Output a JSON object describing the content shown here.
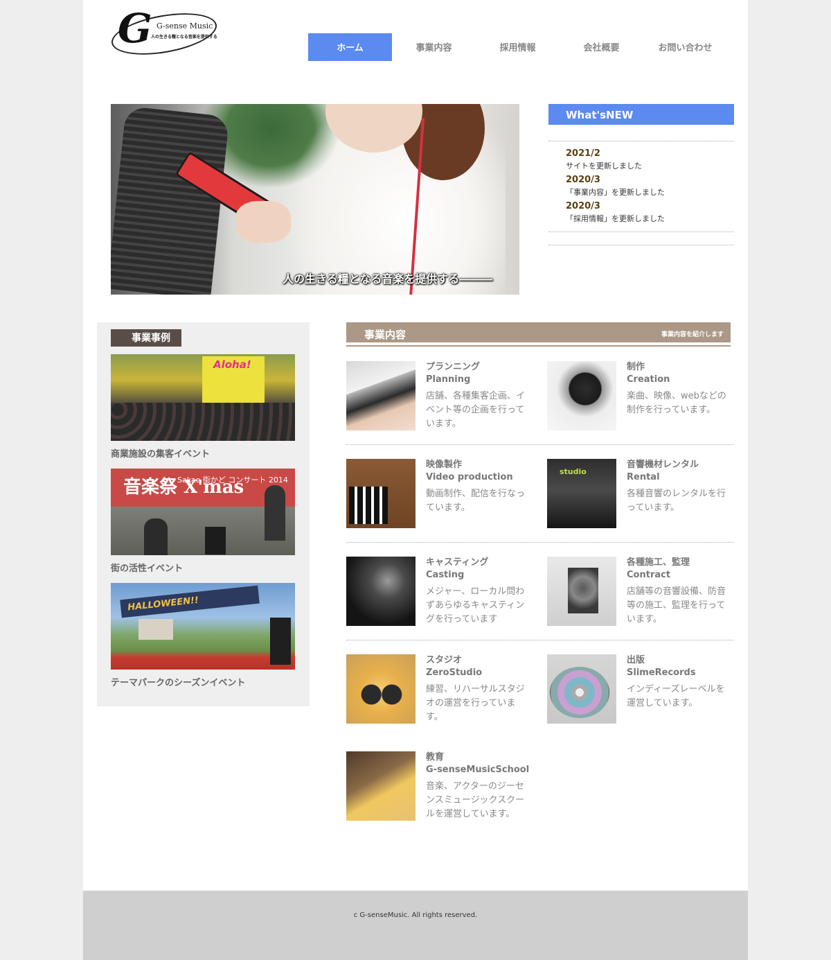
{
  "logo": {
    "initial": "G",
    "name": "G-sense Music",
    "tagline": "人の生きる糧となる音楽を提供する"
  },
  "nav": [
    {
      "label": "ホーム",
      "active": true
    },
    {
      "label": "事業内容",
      "active": false
    },
    {
      "label": "採用情報",
      "active": false
    },
    {
      "label": "会社概要",
      "active": false
    },
    {
      "label": "お問い合わせ",
      "active": false
    }
  ],
  "hero": {
    "caption": "人の生きる糧となる音楽を提供する―――"
  },
  "news": {
    "title": "What'sNEW",
    "items": [
      {
        "date": "2021/2",
        "text": "サイトを更新しました"
      },
      {
        "date": "2020/3",
        "text": "「事業内容」を更新しました"
      },
      {
        "date": "2020/3",
        "text": "「採用情報」を更新しました"
      }
    ]
  },
  "cases": {
    "title": "事業事例",
    "items": [
      {
        "label": "商業施設の集客イベント",
        "image": {
          "sign": "Aloha!"
        }
      },
      {
        "label": "街の活性イベント",
        "image": {
          "banner": "音楽祭 X'mas",
          "sub": "Sakae 街かど コンサート 2014"
        }
      },
      {
        "label": "テーマパークのシーズンイベント",
        "image": {
          "banner": "HALLOWEEN!!"
        }
      }
    ]
  },
  "business": {
    "title": "事業内容",
    "subtitle": "事業内容を紹介します",
    "services": [
      {
        "title": "プランニング",
        "en": "Planning",
        "desc": "店舗、各種集客企画、イベント等の企画を行っています。",
        "icon": "keyboard-photo"
      },
      {
        "title": "制作",
        "en": "Creation",
        "desc": "楽曲、映像、webなどの制作を行っています。",
        "icon": "microphone-photo"
      },
      {
        "title": "映像製作",
        "en": "Video production",
        "desc": "動画制作、配信を行なっています。",
        "icon": "clapperboard-photo"
      },
      {
        "title": "音響機材レンタル",
        "en": "Rental",
        "desc": "各種音響のレンタルを行っています。",
        "icon": "studio-photo"
      },
      {
        "title": "キャスティング",
        "en": "Casting",
        "desc": "メジャー、ローカル問わずあらゆるキャスティングを行っています",
        "icon": "singer-photo"
      },
      {
        "title": "各種施工、監理",
        "en": "Contract",
        "desc": "店舗等の音響設備、防音等の施工、監理を行っています。",
        "icon": "speaker-photo"
      },
      {
        "title": "スタジオ",
        "en": "ZeroStudio",
        "desc": "練習、リハーサルスタジオの運営を行っています。",
        "icon": "drums-photo"
      },
      {
        "title": "出版",
        "en": "SlimeRecords",
        "desc": "インディーズレーベルを運営しています。",
        "icon": "cd-photo"
      },
      {
        "title": "教育",
        "en": "G-senseMusicSchool",
        "desc": "音楽、アクターのジーセンスミュージックスクールを運営しています。",
        "icon": "bass-photo"
      }
    ]
  },
  "footer": {
    "copyright": "c G-senseMusic. All rights reserved."
  },
  "colors": {
    "accent": "#5b8af0",
    "section_brown": "#ac9886",
    "case_head": "#5a4d47",
    "date": "#5a3f0e"
  }
}
